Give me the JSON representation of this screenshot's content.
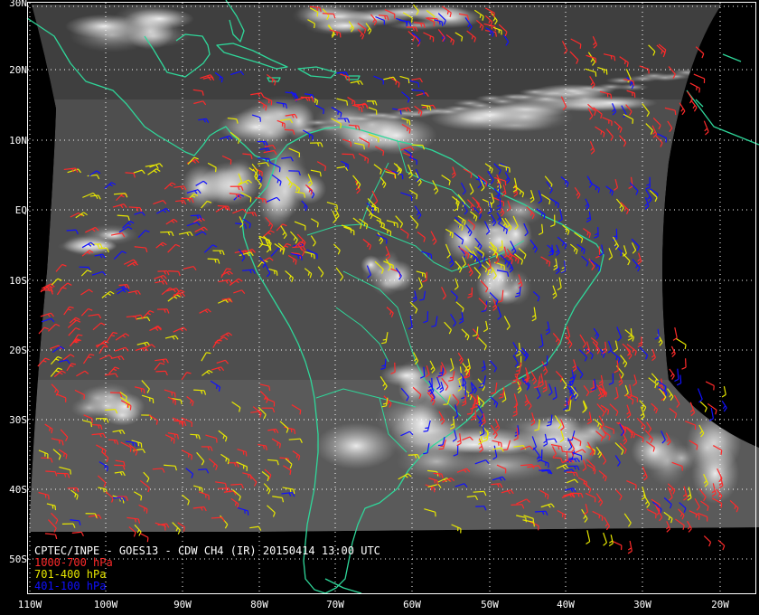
{
  "caption": {
    "title": "CPTEC/INPE - GOES13 - CDW CH4 (IR) 20150414 13:00 UTC"
  },
  "legend": [
    {
      "label": "1000-700 hPa",
      "color": "#ff2a2a"
    },
    {
      "label": "701-400 hPa",
      "color": "#e8e800"
    },
    {
      "label": "401-100 hPa",
      "color": "#1010ff"
    }
  ],
  "latitude_labels": [
    "30N",
    "20N",
    "10N",
    "EQ",
    "10S",
    "20S",
    "30S",
    "40S",
    "50S"
  ],
  "longitude_labels": [
    "110W",
    "100W",
    "90W",
    "80W",
    "70W",
    "60W",
    "50W",
    "40W",
    "30W",
    "20W"
  ],
  "colors": {
    "coastline": "#2fd79a",
    "grid": "#ffffff",
    "frame": "#ffffff",
    "background": "#000000"
  }
}
